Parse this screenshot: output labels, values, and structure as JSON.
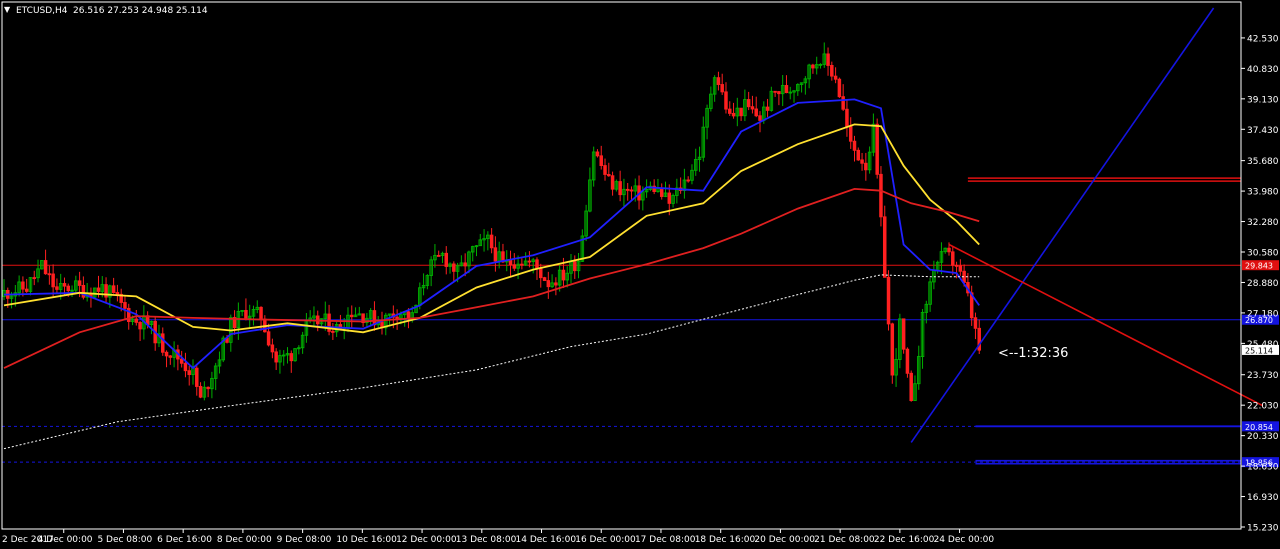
{
  "header": {
    "symbol": "ETCUSD,H4",
    "ohlc": "26.516 27.253 24.948 25.114",
    "arrow": "▼"
  },
  "timer": {
    "label": "<--1:32:36"
  },
  "colors": {
    "background": "#000000",
    "grid_axis": "#ffffff",
    "bull": "#00b000",
    "bear": "#ff2020",
    "ma_fast": "#2020ff",
    "ma_mid": "#ffe030",
    "ma_slow": "#e02020",
    "ma_long": "#ffffff",
    "trend_up": "#1414e0",
    "trend_down": "#e01010"
  },
  "chart_data": {
    "type": "candlestick",
    "symbol": "ETCUSD",
    "timeframe": "H4",
    "ylim": [
      15.23,
      44.2
    ],
    "y_ticks": [
      "42.530",
      "40.830",
      "39.130",
      "37.430",
      "35.680",
      "33.980",
      "32.280",
      "30.580",
      "28.880",
      "27.180",
      "25.480",
      "23.730",
      "22.030",
      "20.330",
      "18.630",
      "16.930",
      "15.230"
    ],
    "x_ticks": [
      "2 Dec 2017",
      "4 Dec 00:00",
      "5 Dec 08:00",
      "6 Dec 16:00",
      "8 Dec 00:00",
      "9 Dec 08:00",
      "10 Dec 16:00",
      "12 Dec 00:00",
      "13 Dec 08:00",
      "14 Dec 16:00",
      "16 Dec 00:00",
      "17 Dec 08:00",
      "18 Dec 16:00",
      "20 Dec 00:00",
      "21 Dec 08:00",
      "22 Dec 16:00",
      "24 Dec 00:00"
    ],
    "close_path": [
      [
        0,
        28.3
      ],
      [
        6,
        28.6
      ],
      [
        10,
        29.8
      ],
      [
        14,
        28.4
      ],
      [
        18,
        28.7
      ],
      [
        22,
        28.4
      ],
      [
        26,
        28.6
      ],
      [
        30,
        27.9
      ],
      [
        34,
        26.8
      ],
      [
        38,
        26.6
      ],
      [
        42,
        25.3
      ],
      [
        46,
        24.7
      ],
      [
        50,
        23.8
      ],
      [
        52,
        22.3
      ],
      [
        56,
        24.3
      ],
      [
        60,
        26.5
      ],
      [
        64,
        27.3
      ],
      [
        68,
        27.0
      ],
      [
        72,
        24.5
      ],
      [
        76,
        24.9
      ],
      [
        80,
        26.4
      ],
      [
        84,
        26.8
      ],
      [
        88,
        26.3
      ],
      [
        92,
        27.3
      ],
      [
        96,
        27.0
      ],
      [
        100,
        26.7
      ],
      [
        104,
        27.3
      ],
      [
        108,
        26.9
      ],
      [
        112,
        29.6
      ],
      [
        116,
        30.4
      ],
      [
        120,
        29.4
      ],
      [
        124,
        30.6
      ],
      [
        128,
        31.2
      ],
      [
        132,
        29.8
      ],
      [
        136,
        30.2
      ],
      [
        140,
        29.9
      ],
      [
        144,
        28.9
      ],
      [
        148,
        29.3
      ],
      [
        152,
        30.2
      ],
      [
        156,
        36.3
      ],
      [
        160,
        34.5
      ],
      [
        164,
        34.0
      ],
      [
        168,
        33.8
      ],
      [
        172,
        34.2
      ],
      [
        176,
        33.3
      ],
      [
        180,
        34.5
      ],
      [
        184,
        36.1
      ],
      [
        188,
        40.7
      ],
      [
        192,
        38.1
      ],
      [
        196,
        38.7
      ],
      [
        200,
        38.1
      ],
      [
        204,
        39.5
      ],
      [
        208,
        39.7
      ],
      [
        212,
        40.5
      ],
      [
        216,
        41.5
      ],
      [
        220,
        40.4
      ],
      [
        224,
        36.5
      ],
      [
        228,
        35.5
      ],
      [
        230,
        37.3
      ],
      [
        233,
        29.5
      ],
      [
        235,
        23.5
      ],
      [
        237,
        26.5
      ],
      [
        240,
        21.9
      ],
      [
        243,
        26.8
      ],
      [
        246,
        29.8
      ],
      [
        249,
        30.4
      ],
      [
        252,
        29.9
      ],
      [
        255,
        28.0
      ],
      [
        258,
        25.1
      ]
    ],
    "moving_averages": [
      {
        "color": "#2020ff",
        "points": [
          [
            0,
            28.2
          ],
          [
            20,
            28.3
          ],
          [
            35,
            27.1
          ],
          [
            50,
            24.1
          ],
          [
            60,
            26.0
          ],
          [
            75,
            26.5
          ],
          [
            95,
            26.3
          ],
          [
            110,
            27.6
          ],
          [
            125,
            29.8
          ],
          [
            140,
            30.4
          ],
          [
            155,
            31.4
          ],
          [
            170,
            34.2
          ],
          [
            185,
            34.0
          ],
          [
            195,
            37.3
          ],
          [
            210,
            38.9
          ],
          [
            225,
            39.1
          ],
          [
            232,
            38.6
          ],
          [
            238,
            31.0
          ],
          [
            245,
            29.6
          ],
          [
            252,
            29.4
          ],
          [
            258,
            27.6
          ]
        ]
      },
      {
        "color": "#ffe030",
        "points": [
          [
            0,
            27.6
          ],
          [
            20,
            28.3
          ],
          [
            35,
            28.1
          ],
          [
            50,
            26.4
          ],
          [
            60,
            26.2
          ],
          [
            75,
            26.6
          ],
          [
            95,
            26.1
          ],
          [
            110,
            26.9
          ],
          [
            125,
            28.6
          ],
          [
            140,
            29.6
          ],
          [
            155,
            30.3
          ],
          [
            170,
            32.6
          ],
          [
            185,
            33.3
          ],
          [
            195,
            35.1
          ],
          [
            210,
            36.6
          ],
          [
            225,
            37.7
          ],
          [
            232,
            37.6
          ],
          [
            238,
            35.4
          ],
          [
            245,
            33.5
          ],
          [
            252,
            32.3
          ],
          [
            258,
            31.0
          ]
        ]
      },
      {
        "color": "#e02020",
        "points": [
          [
            0,
            24.1
          ],
          [
            20,
            26.1
          ],
          [
            35,
            27.0
          ],
          [
            50,
            26.9
          ],
          [
            70,
            26.8
          ],
          [
            95,
            26.7
          ],
          [
            110,
            26.9
          ],
          [
            125,
            27.5
          ],
          [
            140,
            28.1
          ],
          [
            155,
            29.1
          ],
          [
            170,
            29.9
          ],
          [
            185,
            30.8
          ],
          [
            195,
            31.6
          ],
          [
            210,
            33.0
          ],
          [
            225,
            34.1
          ],
          [
            232,
            34.0
          ],
          [
            240,
            33.3
          ],
          [
            250,
            32.8
          ],
          [
            258,
            32.3
          ]
        ]
      },
      {
        "color": "#ffffff",
        "points": [
          [
            0,
            19.6
          ],
          [
            30,
            21.1
          ],
          [
            60,
            22.0
          ],
          [
            95,
            23.0
          ],
          [
            125,
            24.0
          ],
          [
            150,
            25.3
          ],
          [
            170,
            26.0
          ],
          [
            190,
            27.1
          ],
          [
            210,
            28.2
          ],
          [
            225,
            29.0
          ],
          [
            232,
            29.3
          ],
          [
            245,
            29.2
          ],
          [
            258,
            29.2
          ]
        ]
      }
    ],
    "horizontal_levels": [
      {
        "value": 34.62,
        "color": "#e01010",
        "style": "double-thick",
        "from": 255,
        "label": ""
      },
      {
        "value": 29.843,
        "color": "#e01010",
        "style": "solid",
        "label": "29.843"
      },
      {
        "value": 26.8,
        "color": "#1414e0",
        "style": "solid",
        "label": "26.870"
      },
      {
        "value": 20.85,
        "color": "#1414e0",
        "style": "dotted",
        "label": "20.854"
      },
      {
        "value": 18.85,
        "color": "#1414e0",
        "style": "dotted",
        "label": "18.856"
      },
      {
        "value": 20.85,
        "color": "#1414e0",
        "style": "solid",
        "from": 257,
        "label": ""
      },
      {
        "value": 18.85,
        "color": "#1414e0",
        "style": "solid-double",
        "from": 257,
        "label": ""
      }
    ],
    "trendlines": [
      {
        "color": "#1414e0",
        "from": [
          240,
          19.95
        ],
        "to": [
          320,
          44.2
        ]
      },
      {
        "color": "#e01010",
        "from": [
          250,
          31.0
        ],
        "to": [
          333,
          22.0
        ]
      }
    ],
    "current_price": {
      "value": 25.114,
      "label": "25.114"
    }
  }
}
